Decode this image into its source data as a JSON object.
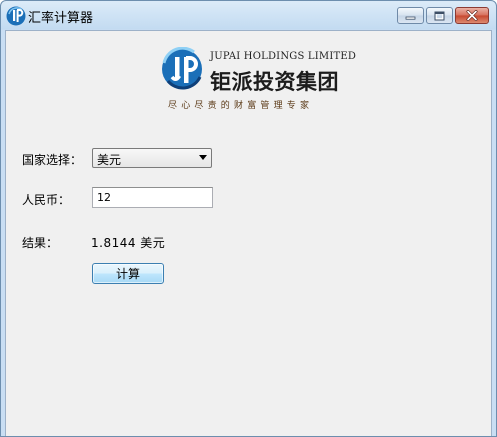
{
  "window": {
    "title": "汇率计算器",
    "icon": "jupai-logo-icon",
    "buttons": {
      "minimize": "minimize-icon",
      "maximize": "maximize-icon",
      "close": "close-icon"
    }
  },
  "logo": {
    "english_name": "JUPAI HOLDINGS LIMITED",
    "chinese_name": "钜派投资集团",
    "slogan": "尽心尽责的财富管理专家",
    "colors": {
      "blue": "#1b6fb8",
      "dark_blue": "#0e3f78"
    }
  },
  "form": {
    "country_label": "国家选择：",
    "country_selected": "美元",
    "rmb_label": "人民币：",
    "rmb_value": "12",
    "result_label": "结果：",
    "result_value": "1.8144 美元",
    "calc_button": "计算"
  }
}
